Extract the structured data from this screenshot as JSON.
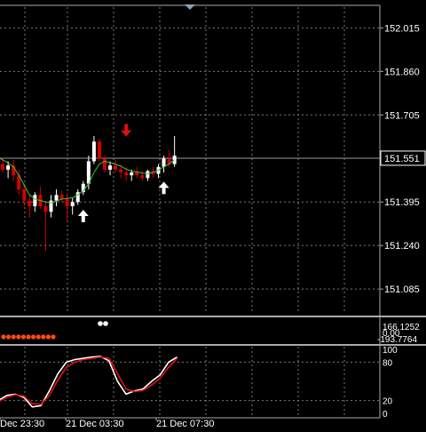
{
  "chart_data": [
    {
      "type": "candlestick",
      "title": "",
      "ylim": [
        151.0,
        152.07
      ],
      "price_ticks": [
        "152.015",
        "151.860",
        "151.705",
        "151.551",
        "151.395",
        "151.240",
        "151.085"
      ],
      "current_price": "151.551",
      "time_ticks": [
        "Dec 23:30",
        "21 Dec 03:30",
        "21 Dec 07:30"
      ],
      "grid": true,
      "colors": {
        "bull": "#ffffff",
        "bear": "#d40000",
        "ma_line": "#3cc43c",
        "grid": "#7a7a7a",
        "background": "#000000"
      },
      "candles": [
        {
          "o": 151.54,
          "h": 151.565,
          "l": 151.515,
          "c": 151.53
        },
        {
          "o": 151.53,
          "h": 151.55,
          "l": 151.5,
          "c": 151.51
        },
        {
          "o": 151.51,
          "h": 151.54,
          "l": 151.48,
          "c": 151.525
        },
        {
          "o": 151.525,
          "h": 151.545,
          "l": 151.47,
          "c": 151.49
        },
        {
          "o": 151.49,
          "h": 151.51,
          "l": 151.42,
          "c": 151.44
        },
        {
          "o": 151.44,
          "h": 151.46,
          "l": 151.38,
          "c": 151.4
        },
        {
          "o": 151.4,
          "h": 151.42,
          "l": 151.34,
          "c": 151.38
        },
        {
          "o": 151.38,
          "h": 151.43,
          "l": 151.36,
          "c": 151.42
        },
        {
          "o": 151.42,
          "h": 151.45,
          "l": 151.37,
          "c": 151.38
        },
        {
          "o": 151.38,
          "h": 151.4,
          "l": 151.22,
          "c": 151.36
        },
        {
          "o": 151.36,
          "h": 151.42,
          "l": 151.34,
          "c": 151.4
        },
        {
          "o": 151.4,
          "h": 151.44,
          "l": 151.38,
          "c": 151.42
        },
        {
          "o": 151.42,
          "h": 151.435,
          "l": 151.395,
          "c": 151.405
        },
        {
          "o": 151.405,
          "h": 151.42,
          "l": 151.33,
          "c": 151.38
        },
        {
          "o": 151.38,
          "h": 151.41,
          "l": 151.35,
          "c": 151.395
        },
        {
          "o": 151.395,
          "h": 151.44,
          "l": 151.385,
          "c": 151.43
        },
        {
          "o": 151.43,
          "h": 151.47,
          "l": 151.42,
          "c": 151.46
        },
        {
          "o": 151.46,
          "h": 151.56,
          "l": 151.44,
          "c": 151.54
        },
        {
          "o": 151.54,
          "h": 151.63,
          "l": 151.53,
          "c": 151.61
        },
        {
          "o": 151.61,
          "h": 151.62,
          "l": 151.54,
          "c": 151.55
        },
        {
          "o": 151.55,
          "h": 151.56,
          "l": 151.5,
          "c": 151.51
        },
        {
          "o": 151.51,
          "h": 151.54,
          "l": 151.49,
          "c": 151.525
        },
        {
          "o": 151.525,
          "h": 151.545,
          "l": 151.5,
          "c": 151.51
        },
        {
          "o": 151.51,
          "h": 151.53,
          "l": 151.48,
          "c": 151.5
        },
        {
          "o": 151.5,
          "h": 151.52,
          "l": 151.47,
          "c": 151.49
        },
        {
          "o": 151.49,
          "h": 151.51,
          "l": 151.47,
          "c": 151.5
        },
        {
          "o": 151.5,
          "h": 151.52,
          "l": 151.48,
          "c": 151.49
        },
        {
          "o": 151.49,
          "h": 151.505,
          "l": 151.47,
          "c": 151.48
        },
        {
          "o": 151.48,
          "h": 151.51,
          "l": 151.47,
          "c": 151.505
        },
        {
          "o": 151.505,
          "h": 151.52,
          "l": 151.48,
          "c": 151.495
        },
        {
          "o": 151.495,
          "h": 151.53,
          "l": 151.48,
          "c": 151.52
        },
        {
          "o": 151.52,
          "h": 151.56,
          "l": 151.5,
          "c": 151.55
        },
        {
          "o": 151.55,
          "h": 151.58,
          "l": 151.52,
          "c": 151.53
        },
        {
          "o": 151.53,
          "h": 151.63,
          "l": 151.52,
          "c": 151.56
        }
      ],
      "ma": [
        151.555,
        151.545,
        151.535,
        151.52,
        151.49,
        151.455,
        151.42,
        151.405,
        151.4,
        151.395,
        151.392,
        151.398,
        151.405,
        151.408,
        151.41,
        151.42,
        151.435,
        151.46,
        151.5,
        151.53,
        151.54,
        151.535,
        151.53,
        151.522,
        151.512,
        151.505,
        151.502,
        151.498,
        151.496,
        151.5,
        151.508,
        151.52,
        151.53,
        151.545
      ],
      "arrows": [
        {
          "index": 16,
          "dir": "up",
          "price": 151.345,
          "color": "#ffffff"
        },
        {
          "index": 24,
          "dir": "down",
          "price": 151.65,
          "color": "#e01010"
        },
        {
          "index": 31,
          "dir": "up",
          "price": 151.445,
          "color": "#ffffff"
        }
      ]
    },
    {
      "type": "indicator",
      "labels": [
        "166.1252",
        "0.00",
        "-193.7764"
      ],
      "dots": {
        "count": 11,
        "color": "#ff4a14"
      },
      "markers": {
        "count": 2,
        "color": "#ffffff"
      }
    },
    {
      "type": "line",
      "ylim": [
        0,
        100
      ],
      "ticks": [
        "100",
        "80",
        "20",
        "0"
      ],
      "series": [
        {
          "color": "#ffffff",
          "values": [
            20,
            28,
            30,
            25,
            10,
            12,
            35,
            62,
            80,
            84,
            86,
            88,
            89,
            82,
            50,
            30,
            35,
            38,
            50,
            60,
            80,
            88
          ]
        },
        {
          "color": "#e01010",
          "values": [
            18,
            25,
            29,
            27,
            15,
            14,
            28,
            52,
            72,
            80,
            84,
            86,
            88,
            86,
            62,
            38,
            34,
            36,
            44,
            55,
            72,
            86
          ]
        }
      ]
    }
  ]
}
